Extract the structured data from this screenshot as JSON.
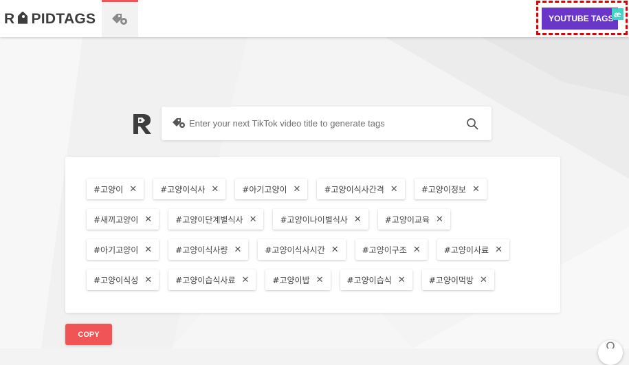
{
  "header": {
    "logo_text_left": "R",
    "logo_text_right": "PIDTAGS",
    "youtube_button_label": "YOUTUBE TAGS",
    "extension_badge": "æ"
  },
  "search": {
    "placeholder": "Enter your next TikTok video title to generate tags",
    "value": ""
  },
  "tags": {
    "row1": [
      "#고양이",
      "#고양이식사",
      "#아기고양이",
      "#고양이식사간격",
      "#고양이정보"
    ],
    "row2": [
      "#새끼고양이",
      "#고양이단계별식사",
      "#고양이나이별식사",
      "#고양이교육"
    ],
    "row3": [
      "#아기고양이",
      "#고양이식사량",
      "#고양이식사시간",
      "#고양이구조",
      "#고양이사료"
    ],
    "row4": [
      "#고양이식성",
      "#고양이습식사료",
      "#고양이밥",
      "#고양이습식",
      "#고양이먹방"
    ],
    "remove_symbol": "✕"
  },
  "actions": {
    "copy_label": "COPY"
  },
  "colors": {
    "accent": "#f05454",
    "youtube_button": "#6a35c9",
    "badge": "#41d3c4",
    "logo": "#3d3d3d"
  }
}
